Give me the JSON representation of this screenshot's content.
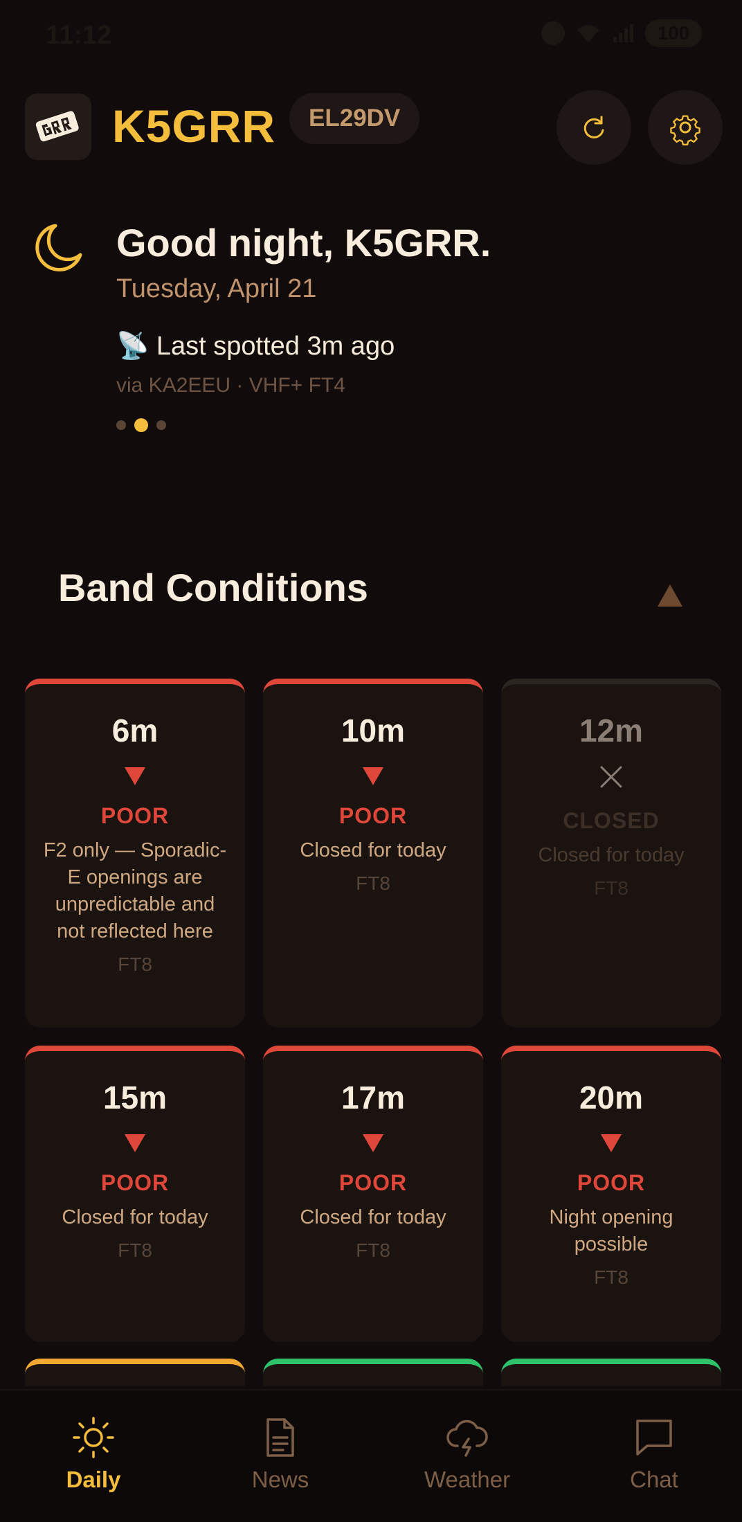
{
  "status_bar": {
    "time": "11:12",
    "battery": "100"
  },
  "header": {
    "callsign": "K5GRR",
    "grid": "EL29DV",
    "logo_icon": "logo-grr",
    "refresh_icon": "refresh-icon",
    "settings_icon": "gear-icon"
  },
  "greeting": {
    "title": "Good night, K5GRR.",
    "date": "Tuesday, April 21",
    "spot_line": "📡 Last spotted 3m ago",
    "spot_via": "via KA2EEU · VHF+ FT4",
    "carousel_active_index": 1
  },
  "band_conditions": {
    "title": "Band Conditions",
    "cards": [
      {
        "band": "6m",
        "status": "POOR",
        "note": "F2 only — Sporadic-E openings are unpredictable and not reflected here",
        "mode": "FT8"
      },
      {
        "band": "10m",
        "status": "POOR",
        "note": "Closed for today",
        "mode": "FT8"
      },
      {
        "band": "12m",
        "status": "CLOSED",
        "note": "Closed for today",
        "mode": "FT8"
      },
      {
        "band": "15m",
        "status": "POOR",
        "note": "Closed for today",
        "mode": "FT8"
      },
      {
        "band": "17m",
        "status": "POOR",
        "note": "Closed for today",
        "mode": "FT8"
      },
      {
        "band": "20m",
        "status": "POOR",
        "note": "Night opening possible",
        "mode": "FT8"
      }
    ]
  },
  "colors": {
    "accent": "#f5bd3c",
    "poor": "#e0473b",
    "fair": "#f0a830",
    "good": "#2ec26a",
    "closed": "#2c2622"
  },
  "tabs": [
    {
      "label": "Daily",
      "icon": "sun-icon",
      "active": true
    },
    {
      "label": "News",
      "icon": "document-icon",
      "active": false
    },
    {
      "label": "Weather",
      "icon": "storm-cloud-icon",
      "active": false
    },
    {
      "label": "Chat",
      "icon": "chat-bubble-icon",
      "active": false
    }
  ]
}
